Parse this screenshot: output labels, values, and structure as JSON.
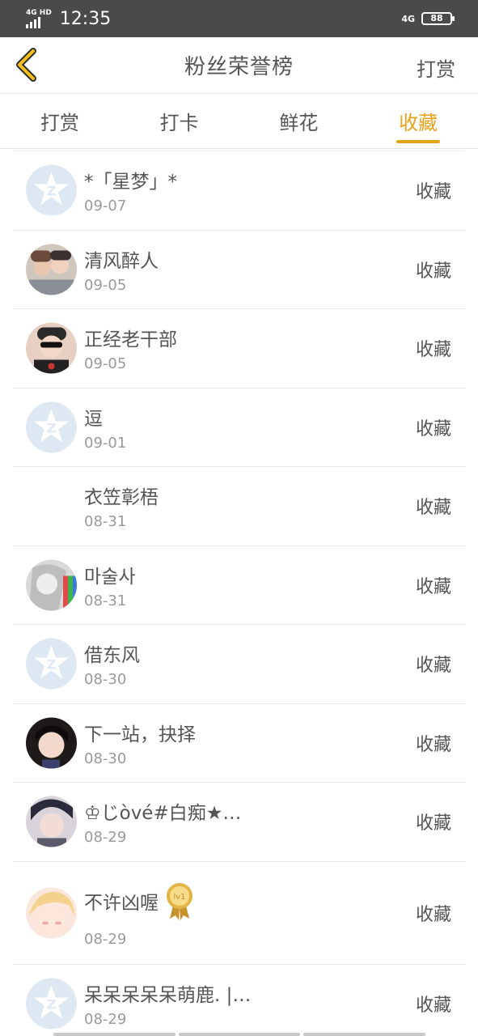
{
  "status_bar": {
    "network": "4G HD",
    "time": "12:35",
    "network_right": "4G",
    "battery": "88"
  },
  "header": {
    "title": "粉丝荣誉榜",
    "right_label": "打赏"
  },
  "tabs": [
    {
      "label": "打赏",
      "active": false
    },
    {
      "label": "打卡",
      "active": false
    },
    {
      "label": "鲜花",
      "active": false
    },
    {
      "label": "收藏",
      "active": true
    }
  ],
  "colors": {
    "accent": "#e8a21c",
    "text": "#555555",
    "subtext": "#9a9a9a"
  },
  "list": [
    {
      "name": "*「星梦」*",
      "date": "09-07",
      "action": "收藏",
      "avatar": "default-star-avatar"
    },
    {
      "name": "清风醉人",
      "date": "09-05",
      "action": "收藏",
      "avatar": "photo-couple"
    },
    {
      "name": "正经老干部",
      "date": "09-05",
      "action": "收藏",
      "avatar": "photo-sunglasses"
    },
    {
      "name": "逗",
      "date": "09-01",
      "action": "收藏",
      "avatar": "default-star-avatar"
    },
    {
      "name": "衣笠彰梧",
      "date": "08-31",
      "action": "收藏",
      "avatar": "none"
    },
    {
      "name": "마술사",
      "date": "08-31",
      "action": "收藏",
      "avatar": "photo-anime-sketch"
    },
    {
      "name": "借东风",
      "date": "08-30",
      "action": "收藏",
      "avatar": "default-star-avatar"
    },
    {
      "name": "下一站，抉择",
      "date": "08-30",
      "action": "收藏",
      "avatar": "photo-girl"
    },
    {
      "name": "♔じòvé#白痴★…",
      "date": "08-29",
      "action": "收藏",
      "avatar": "photo-boy"
    },
    {
      "name": "不许凶喔",
      "date": "08-29",
      "action": "收藏",
      "avatar": "photo-anime-blonde",
      "badge": "lv1"
    },
    {
      "name": "呆呆呆呆呆萌鹿. |…",
      "date": "08-29",
      "action": "收藏",
      "avatar": "default-star-avatar"
    }
  ]
}
